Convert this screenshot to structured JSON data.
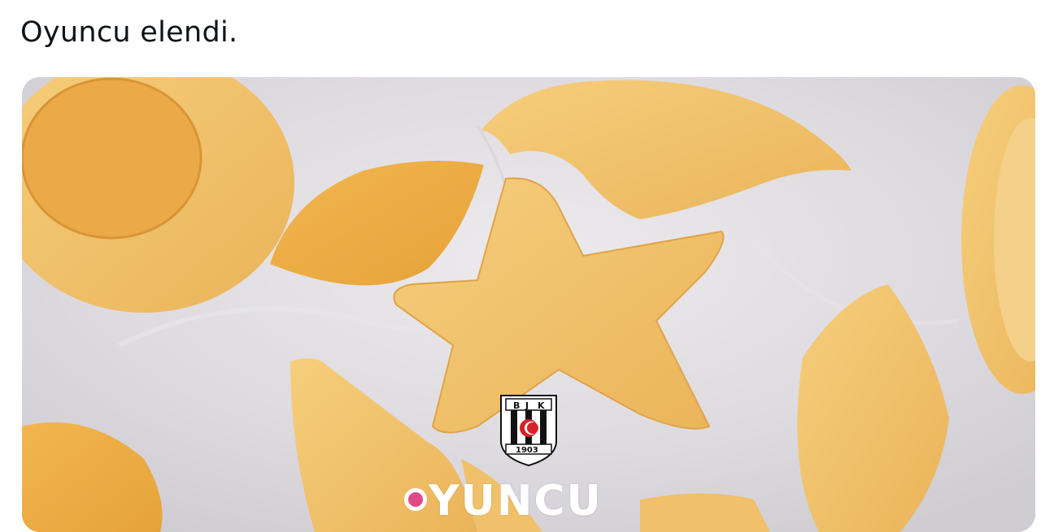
{
  "tweet": {
    "text": "Oyuncu elendi."
  },
  "media": {
    "crest": {
      "initials": [
        "B",
        "J",
        "K"
      ],
      "year": "1903"
    },
    "brand": {
      "dot_color": "#e14a86",
      "word": "YUNCU"
    }
  }
}
